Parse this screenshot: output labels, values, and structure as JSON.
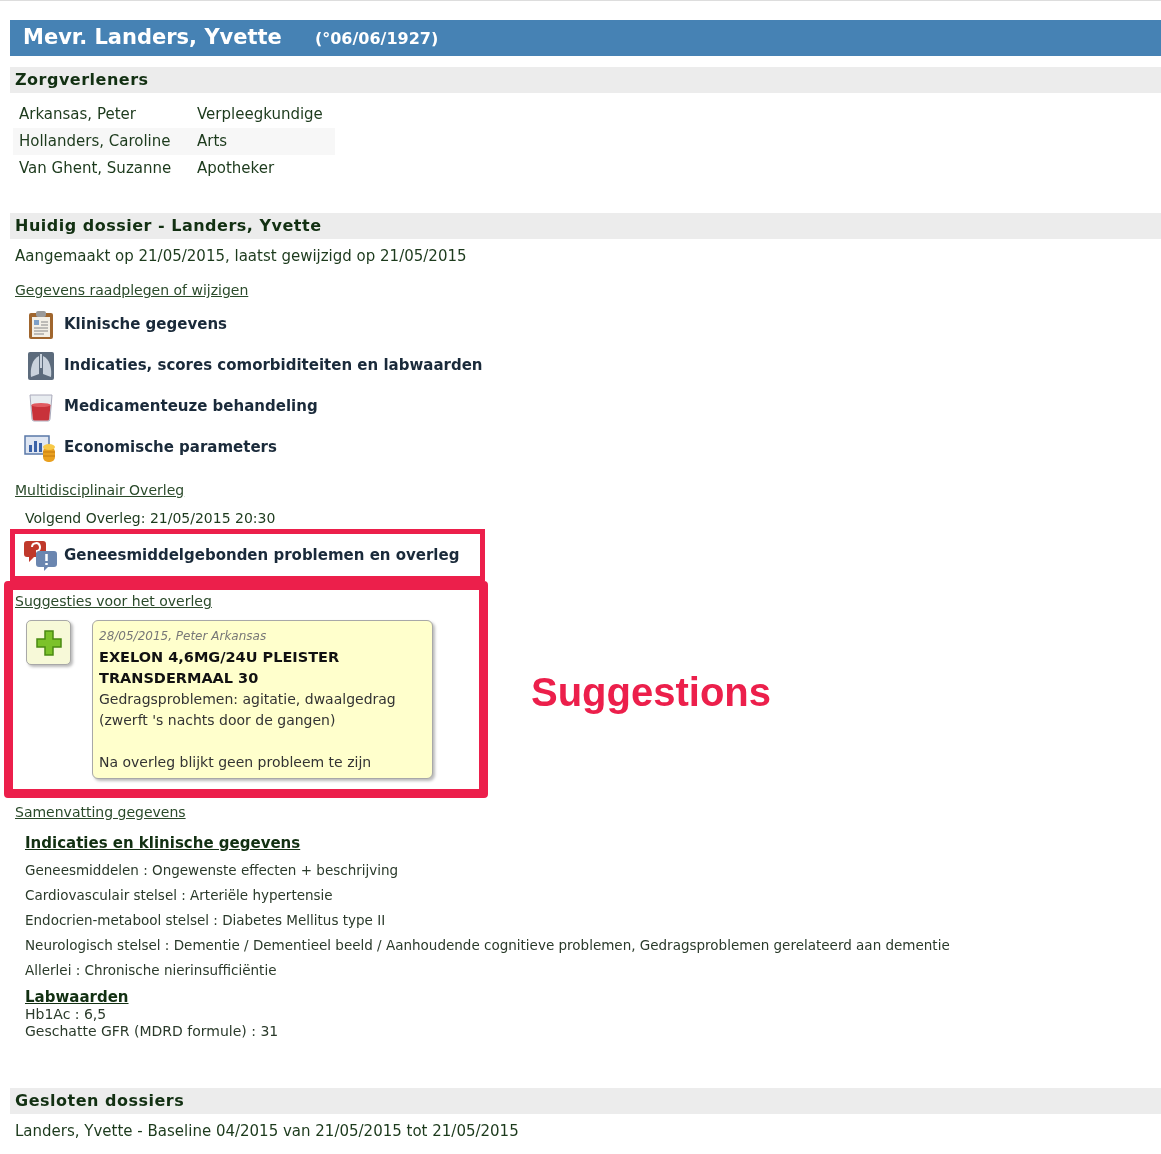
{
  "header": {
    "name": "Mevr. Landers, Yvette",
    "birth": "(°06/06/1927)"
  },
  "caregivers": {
    "title": "Zorgverleners",
    "rows": [
      {
        "name": "Arkansas, Peter",
        "role": "Verpleegkundige"
      },
      {
        "name": "Hollanders, Caroline",
        "role": "Arts"
      },
      {
        "name": "Van Ghent, Suzanne",
        "role": "Apotheker"
      }
    ]
  },
  "current_dossier": {
    "title": "Huidig dossier - Landers, Yvette",
    "created": "Aangemaakt op 21/05/2015, laatst gewijzigd op 21/05/2015",
    "links_heading": "Gegevens raadplegen of wijzigen",
    "items": [
      {
        "label": "Klinische gegevens",
        "kind": "clipboard"
      },
      {
        "label": "Indicaties, scores comorbiditeiten en labwaarden",
        "kind": "lungs"
      },
      {
        "label": "Medicamenteuze behandeling",
        "kind": "glass"
      },
      {
        "label": "Economische parameters",
        "kind": "chart"
      }
    ]
  },
  "overleg": {
    "heading": "Multidisciplinair Overleg",
    "next": "Volgend Overleg: 21/05/2015 20:30",
    "item": {
      "label": "Geneesmiddelgebonden problemen en overleg"
    },
    "suggestions_heading": "Suggesties voor het overleg",
    "suggestion": {
      "meta": "28/05/2015, Peter Arkansas",
      "drug": "EXELON 4,6MG/24U PLEISTER TRANSDERMAAL 30",
      "description": "Gedragsproblemen: agitatie, dwaalgedrag (zwerft 's nachts door de gangen)",
      "conclusion": "Na overleg blijkt geen probleem te zijn"
    }
  },
  "summary": {
    "heading": "Samenvatting gegevens",
    "subheading": "Indicaties en klinische gegevens",
    "lines": [
      "Geneesmiddelen : Ongewenste effecten + beschrijving",
      "Cardiovasculair stelsel : Arteriële hypertensie",
      "Endocrien-metabool stelsel : Diabetes Mellitus type II",
      "Neurologisch stelsel : Dementie / Dementieel beeld / Aanhoudende cognitieve problemen, Gedragsproblemen gerelateerd aan dementie",
      "Allerlei : Chronische nierinsufficiëntie"
    ],
    "lab_heading": "Labwaarden",
    "lab_lines": [
      "Hb1Ac : 6,5",
      "Geschatte GFR (MDRD formule) : 31"
    ]
  },
  "closed": {
    "title": "Gesloten dossiers",
    "items": [
      "Landers, Yvette - Baseline 04/2015 van 21/05/2015 tot 21/05/2015"
    ]
  },
  "annotation": {
    "label": "Suggestions"
  }
}
